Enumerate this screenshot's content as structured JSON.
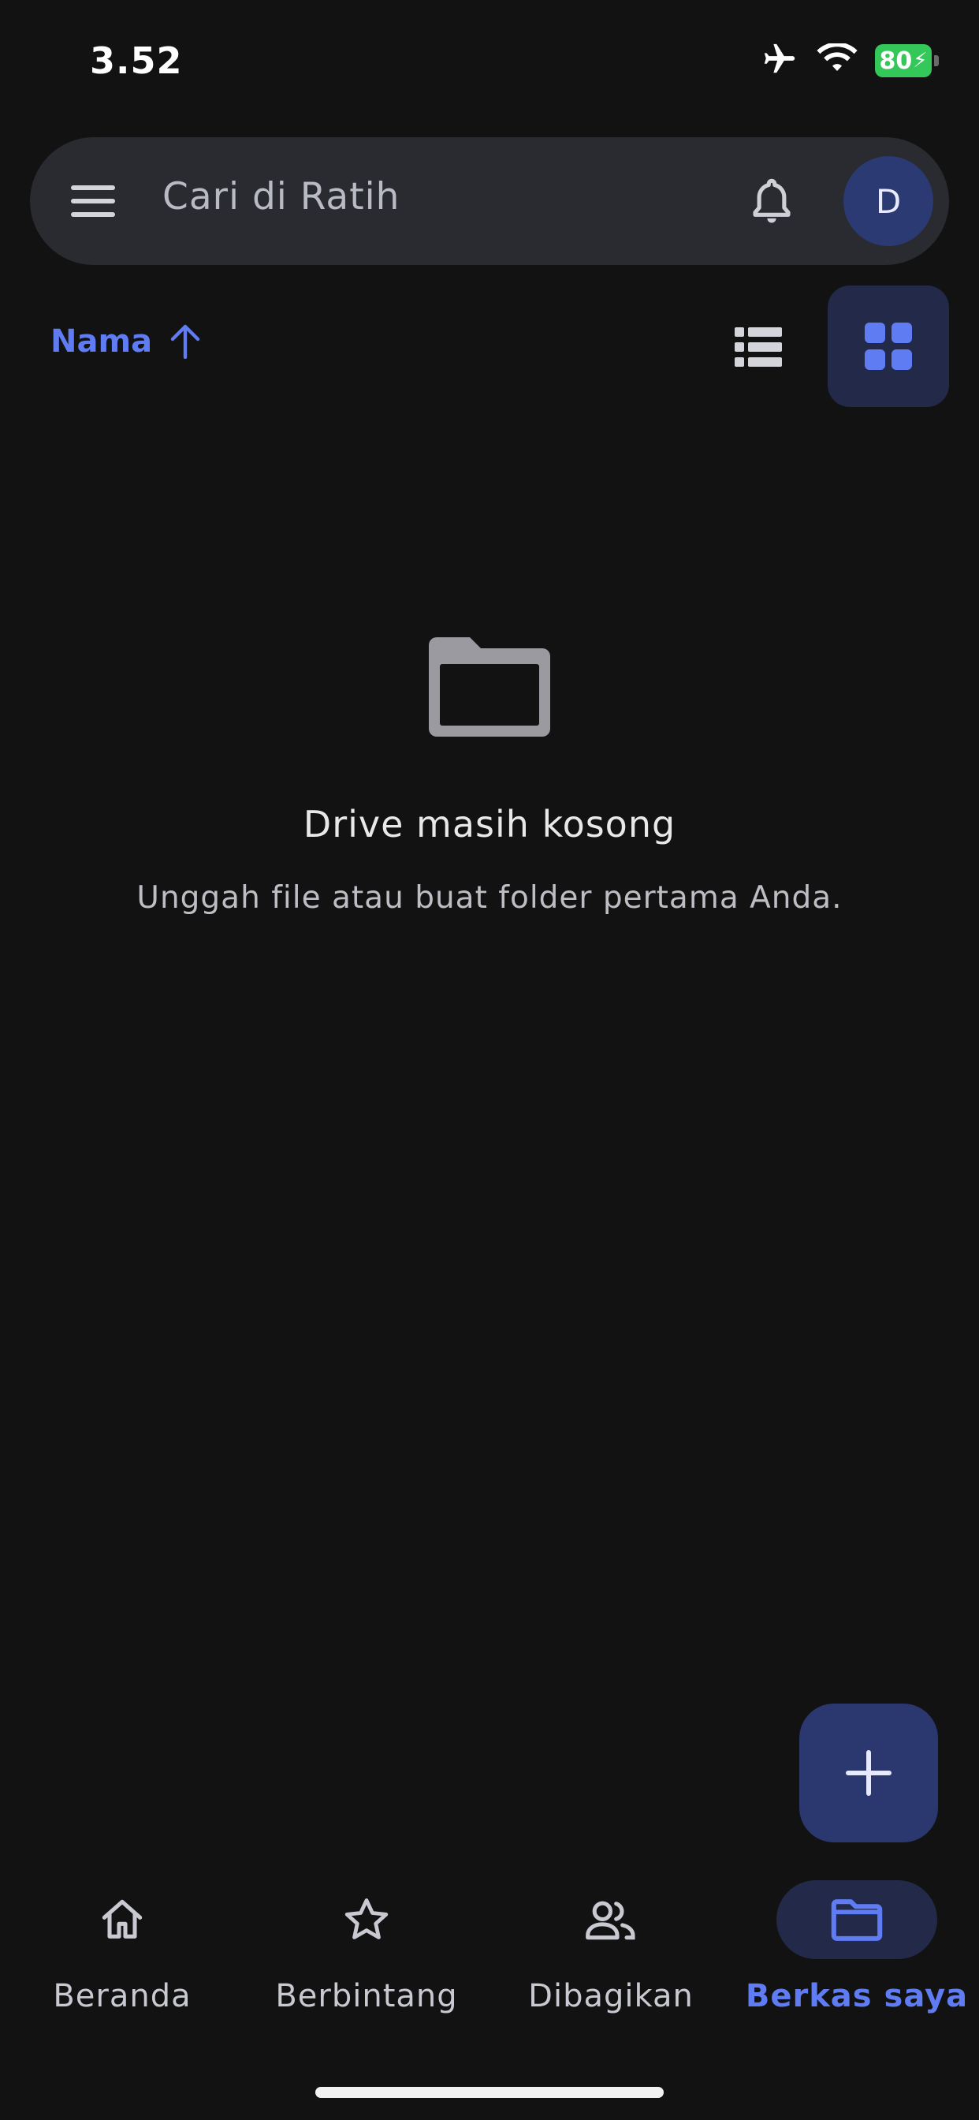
{
  "status_bar": {
    "time": "3.52",
    "battery": "80",
    "icons": [
      "airplane-icon",
      "wifi-icon",
      "battery-icon"
    ]
  },
  "search": {
    "placeholder": "Cari di Ratih",
    "avatar_initial": "D"
  },
  "toolbar": {
    "sort_label": "Nama",
    "sort_direction": "ascending",
    "view_mode": "grid"
  },
  "empty_state": {
    "title": "Drive masih kosong",
    "subtitle": "Unggah file atau buat folder pertama Anda."
  },
  "bottom_nav": {
    "items": [
      {
        "label": "Beranda",
        "icon": "home-icon",
        "active": false
      },
      {
        "label": "Berbintang",
        "icon": "star-icon",
        "active": false
      },
      {
        "label": "Dibagikan",
        "icon": "people-icon",
        "active": false
      },
      {
        "label": "Berkas saya",
        "icon": "folder-icon",
        "active": true
      }
    ]
  },
  "colors": {
    "background": "#121212",
    "accent": "#5f7cf2",
    "search_bar": "#2a2b30",
    "active_pill": "#232a49",
    "fab": "#2b386f",
    "avatar": "#2c3a73"
  }
}
